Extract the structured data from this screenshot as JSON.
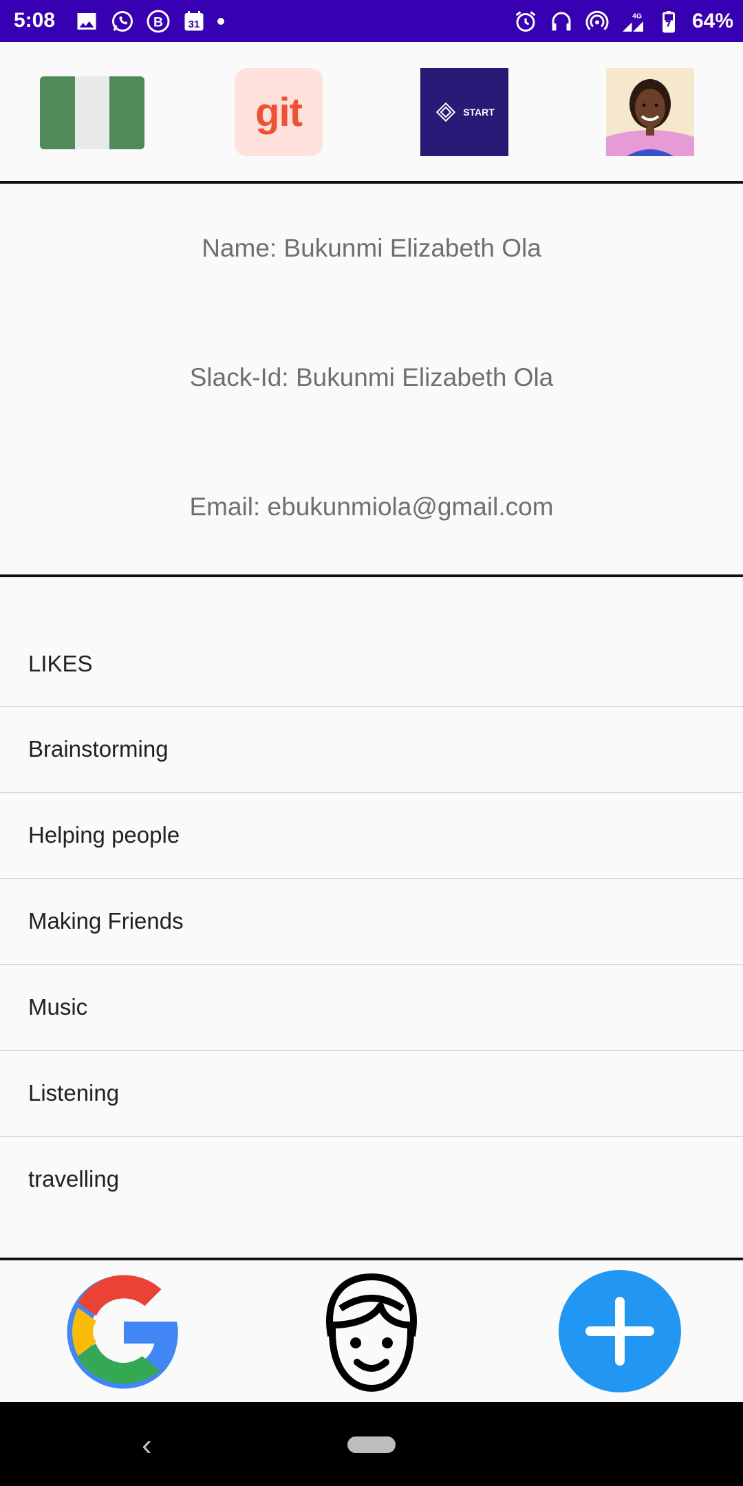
{
  "status_bar": {
    "time": "5:08",
    "battery": "64%",
    "network": "4G",
    "left_icons": [
      "image-icon",
      "whatsapp-icon",
      "b-icon",
      "calendar-icon",
      "dot-icon"
    ],
    "right_icons": [
      "alarm-icon",
      "headphones-icon",
      "hotspot-icon",
      "signal-icon",
      "battery-icon"
    ],
    "calendar_day": "31",
    "b_letter": "B",
    "bg_color": "#3700b3"
  },
  "top_icons": {
    "git_label": "git",
    "start_label": "START",
    "flag_colors": [
      "#4f8a5b",
      "#e8e9ea",
      "#4f8a5b"
    ]
  },
  "profile": {
    "name": "Name: Bukunmi Elizabeth Ola",
    "slack": "Slack-Id: Bukunmi Elizabeth Ola",
    "email": "Email: ebukunmiola@gmail.com"
  },
  "likes": {
    "header": "LIKES",
    "items": [
      "Brainstorming",
      "Helping people",
      "Making Friends",
      "Music",
      "Listening",
      "travelling"
    ]
  },
  "actions": {
    "icons": [
      "google-icon",
      "face-icon",
      "add-icon"
    ],
    "fab_color": "#2196f3"
  }
}
